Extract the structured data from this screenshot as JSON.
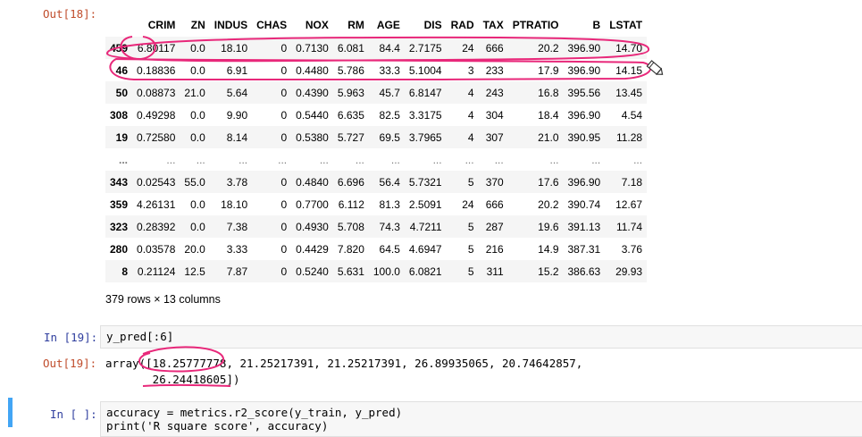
{
  "out18_prompt": "Out[18]:",
  "dataframe": {
    "columns": [
      "CRIM",
      "ZN",
      "INDUS",
      "CHAS",
      "NOX",
      "RM",
      "AGE",
      "DIS",
      "RAD",
      "TAX",
      "PTRATIO",
      "B",
      "LSTAT"
    ],
    "rows": [
      {
        "index": "459",
        "values": [
          "6.80117",
          "0.0",
          "18.10",
          "0",
          "0.7130",
          "6.081",
          "84.4",
          "2.7175",
          "24",
          "666",
          "20.2",
          "396.90",
          "14.70"
        ]
      },
      {
        "index": "46",
        "values": [
          "0.18836",
          "0.0",
          "6.91",
          "0",
          "0.4480",
          "5.786",
          "33.3",
          "5.1004",
          "3",
          "233",
          "17.9",
          "396.90",
          "14.15"
        ]
      },
      {
        "index": "50",
        "values": [
          "0.08873",
          "21.0",
          "5.64",
          "0",
          "0.4390",
          "5.963",
          "45.7",
          "6.8147",
          "4",
          "243",
          "16.8",
          "395.56",
          "13.45"
        ]
      },
      {
        "index": "308",
        "values": [
          "0.49298",
          "0.0",
          "9.90",
          "0",
          "0.5440",
          "6.635",
          "82.5",
          "3.3175",
          "4",
          "304",
          "18.4",
          "396.90",
          "4.54"
        ]
      },
      {
        "index": "19",
        "values": [
          "0.72580",
          "0.0",
          "8.14",
          "0",
          "0.5380",
          "5.727",
          "69.5",
          "3.7965",
          "4",
          "307",
          "21.0",
          "390.95",
          "11.28"
        ]
      },
      {
        "index": "...",
        "values": [
          "...",
          "...",
          "...",
          "...",
          "...",
          "...",
          "...",
          "...",
          "...",
          "...",
          "...",
          "...",
          "..."
        ]
      },
      {
        "index": "343",
        "values": [
          "0.02543",
          "55.0",
          "3.78",
          "0",
          "0.4840",
          "6.696",
          "56.4",
          "5.7321",
          "5",
          "370",
          "17.6",
          "396.90",
          "7.18"
        ]
      },
      {
        "index": "359",
        "values": [
          "4.26131",
          "0.0",
          "18.10",
          "0",
          "0.7700",
          "6.112",
          "81.3",
          "2.5091",
          "24",
          "666",
          "20.2",
          "390.74",
          "12.67"
        ]
      },
      {
        "index": "323",
        "values": [
          "0.28392",
          "0.0",
          "7.38",
          "0",
          "0.4930",
          "5.708",
          "74.3",
          "4.7211",
          "5",
          "287",
          "19.6",
          "391.13",
          "11.74"
        ]
      },
      {
        "index": "280",
        "values": [
          "0.03578",
          "20.0",
          "3.33",
          "0",
          "0.4429",
          "7.820",
          "64.5",
          "4.6947",
          "5",
          "216",
          "14.9",
          "387.31",
          "3.76"
        ]
      },
      {
        "index": "8",
        "values": [
          "0.21124",
          "12.5",
          "7.87",
          "0",
          "0.5240",
          "5.631",
          "100.0",
          "6.0821",
          "5",
          "311",
          "15.2",
          "386.63",
          "29.93"
        ]
      }
    ],
    "shape_note": "379 rows × 13 columns"
  },
  "cell19": {
    "in_prompt": "In [19]:",
    "code": "y_pred[:6]",
    "out_prompt": "Out[19]:",
    "output_line1": "array([18.25777778, 21.25217391, 21.25217391, 26.89935065, 20.74642857,",
    "output_line2": "       26.24418605])"
  },
  "cell20": {
    "in_prompt": "In [ ]:",
    "code_line1": "accuracy = metrics.r2_score(y_train, y_pred)",
    "code_line2": "print('R square score', accuracy)"
  },
  "colors": {
    "annotation": "#e8287a",
    "focus_bar": "#42a5f5",
    "out_prompt": "#c04d2c",
    "in_prompt": "#2f3e9e"
  },
  "icons": [
    "pencil-icon"
  ]
}
